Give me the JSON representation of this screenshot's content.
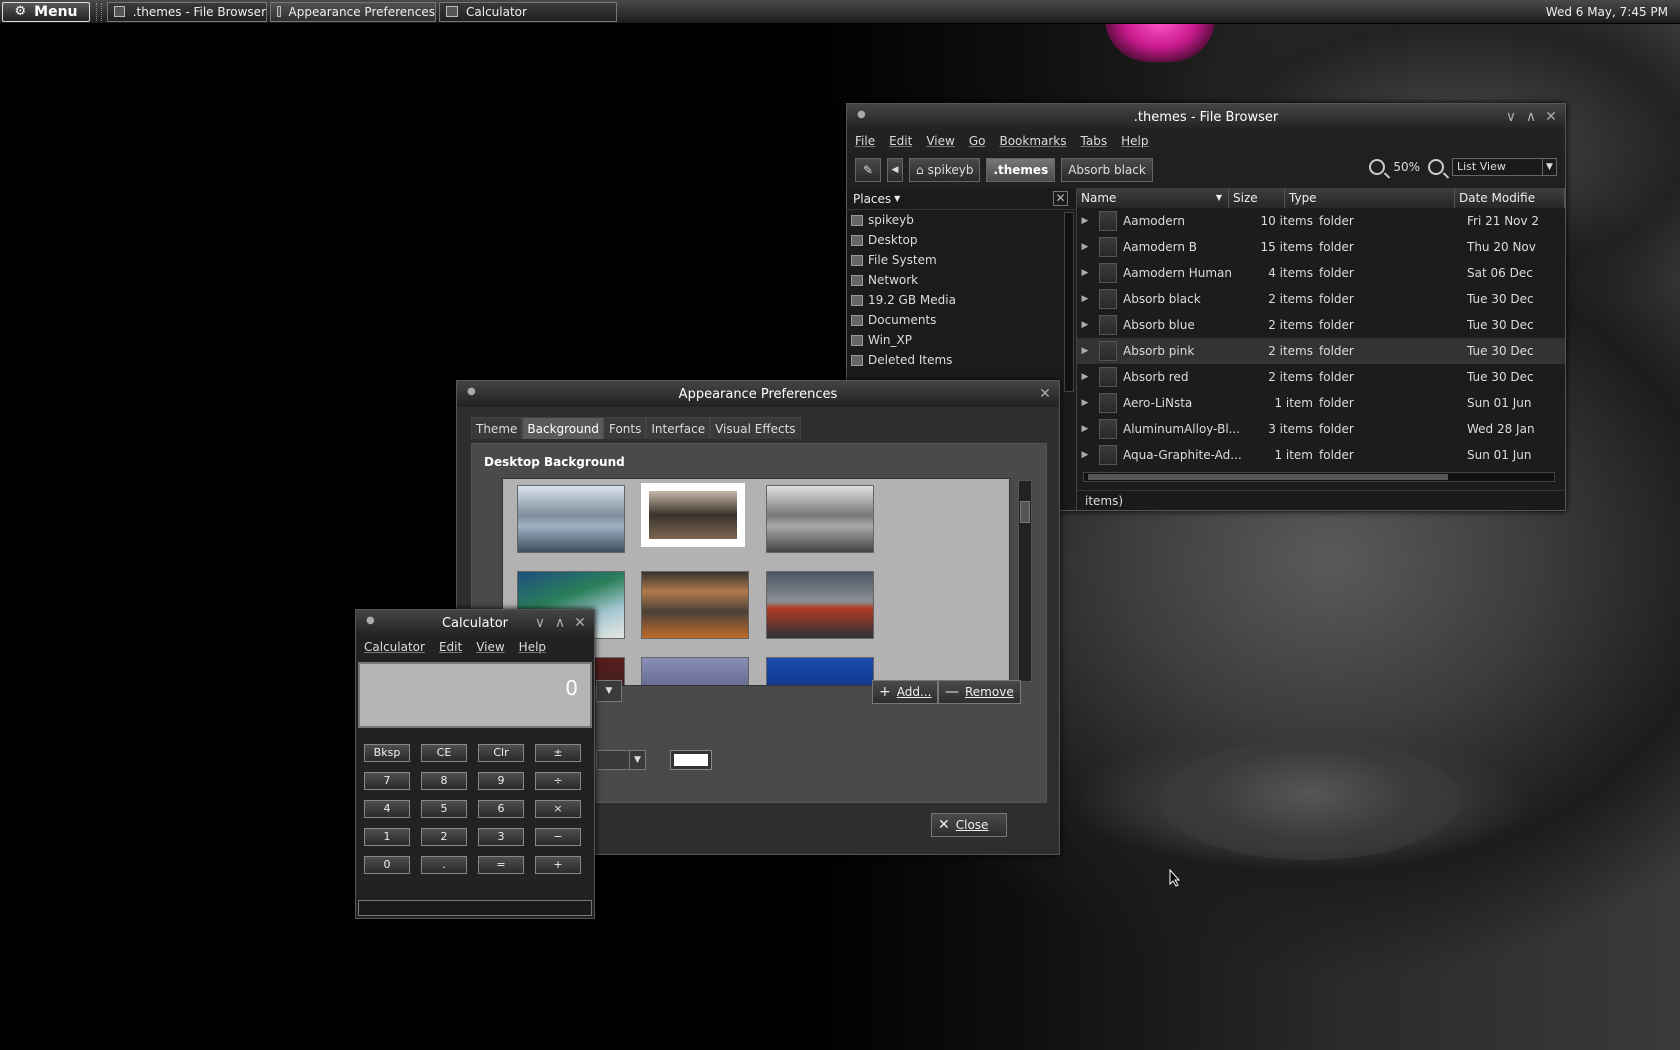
{
  "panel": {
    "menu_label": "Menu",
    "tasks": [
      ".themes - File Browser",
      "Appearance Preferences",
      "Calculator"
    ],
    "clock": "Wed  6 May,  7:45 PM"
  },
  "file_browser": {
    "title": ".themes - File Browser",
    "menus": [
      "File",
      "Edit",
      "View",
      "Go",
      "Bookmarks",
      "Tabs",
      "Help"
    ],
    "path": [
      "spikeyb",
      ".themes",
      "Absorb black"
    ],
    "zoom": "50%",
    "view_mode": "List View",
    "places_label": "Places",
    "places": [
      "spikeyb",
      "Desktop",
      "File System",
      "Network",
      "19.2 GB Media",
      "Documents",
      "Win_XP",
      "Deleted Items"
    ],
    "columns": [
      "Name",
      "Size",
      "Type",
      "Date Modifie"
    ],
    "rows": [
      {
        "name": "Aamodern",
        "size": "10 items",
        "type": "folder",
        "date": "Fri 21 Nov 2"
      },
      {
        "name": "Aamodern B",
        "size": "15 items",
        "type": "folder",
        "date": "Thu 20 Nov"
      },
      {
        "name": "Aamodern Human",
        "size": "4 items",
        "type": "folder",
        "date": "Sat 06 Dec"
      },
      {
        "name": "Absorb black",
        "size": "2 items",
        "type": "folder",
        "date": "Tue 30 Dec"
      },
      {
        "name": "Absorb blue",
        "size": "2 items",
        "type": "folder",
        "date": "Tue 30 Dec"
      },
      {
        "name": "Absorb pink",
        "size": "2 items",
        "type": "folder",
        "date": "Tue 30 Dec"
      },
      {
        "name": "Absorb red",
        "size": "2 items",
        "type": "folder",
        "date": "Tue 30 Dec"
      },
      {
        "name": "Aero-LiNsta",
        "size": "1 item",
        "type": "folder",
        "date": "Sun 01 Jun"
      },
      {
        "name": "AluminumAlloy-Bl...",
        "size": "3 items",
        "type": "folder",
        "date": "Wed 28 Jan"
      },
      {
        "name": "Aqua-Graphite-Ad...",
        "size": "1 item",
        "type": "folder",
        "date": "Sun 01 Jun"
      }
    ],
    "status": "items)"
  },
  "appearance": {
    "title": "Appearance Preferences",
    "tabs": [
      "Theme",
      "Background",
      "Fonts",
      "Interface",
      "Visual Effects"
    ],
    "section": "Desktop Background",
    "add_label": "Add...",
    "remove_label": "Remove",
    "close_label": "Close"
  },
  "calculator": {
    "title": "Calculator",
    "menus": [
      "Calculator",
      "Edit",
      "View",
      "Help"
    ],
    "display": "0",
    "keys": [
      "Bksp",
      "CE",
      "Clr",
      "±",
      "7",
      "8",
      "9",
      "÷",
      "4",
      "5",
      "6",
      "×",
      "1",
      "2",
      "3",
      "−",
      "0",
      ".",
      "=",
      "+"
    ]
  }
}
